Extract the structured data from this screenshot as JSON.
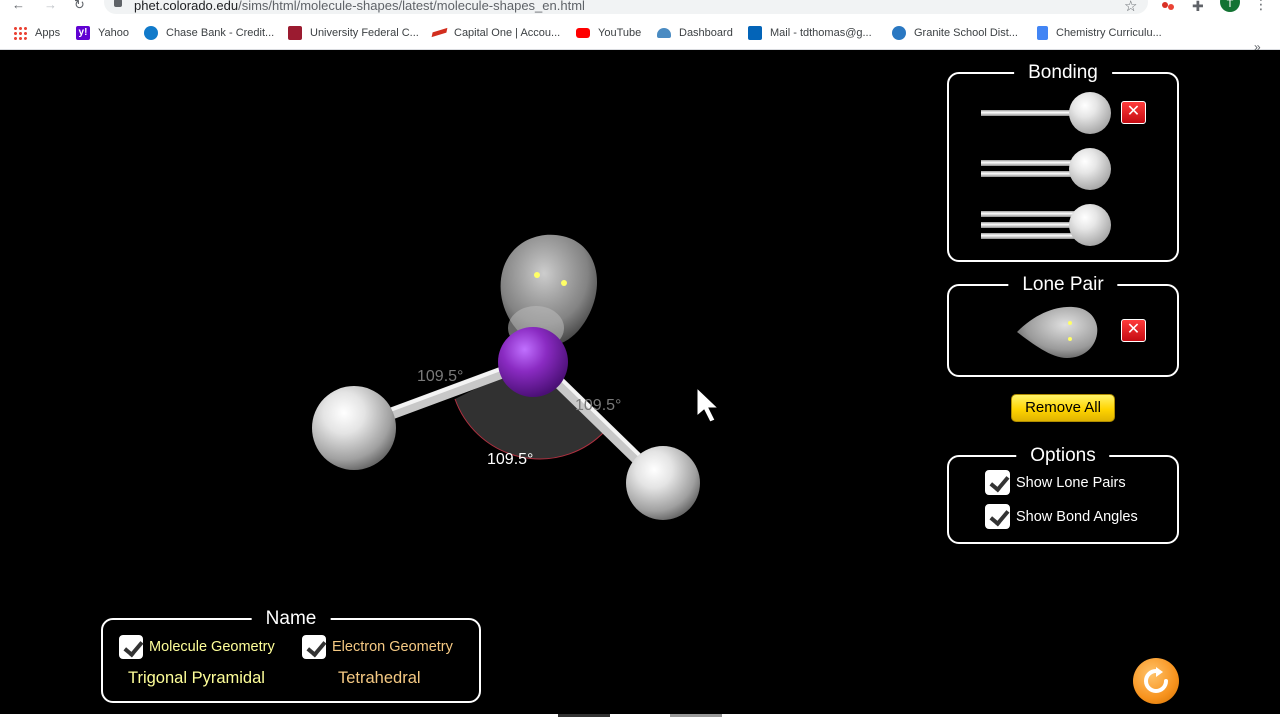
{
  "browser": {
    "url_host": "phet.colorado.edu",
    "url_path": "/sims/html/molecule-shapes/latest/molecule-shapes_en.html",
    "profile_initial": "T",
    "bookmarks": [
      {
        "label": "Apps",
        "icon": "apps-grid-icon"
      },
      {
        "label": "Yahoo",
        "icon": "yahoo-icon"
      },
      {
        "label": "Chase Bank - Credit...",
        "icon": "chase-icon"
      },
      {
        "label": "University Federal C...",
        "icon": "ufcu-icon"
      },
      {
        "label": "Capital One | Accou...",
        "icon": "capital-one-icon"
      },
      {
        "label": "YouTube",
        "icon": "youtube-icon"
      },
      {
        "label": "Dashboard",
        "icon": "dashboard-icon"
      },
      {
        "label": "Mail - tdthomas@g...",
        "icon": "outlook-icon"
      },
      {
        "label": "Granite School Dist...",
        "icon": "granite-icon"
      },
      {
        "label": "Chemistry Curriculu...",
        "icon": "google-doc-icon"
      }
    ],
    "bookmarks_overflow": "»"
  },
  "molecule": {
    "central_atom_color": "#8a2bc2",
    "bonded_atom_color": "#e8e8e8",
    "angles": [
      {
        "value": "109.5°",
        "faded": true
      },
      {
        "value": "109.5°",
        "faded": true
      },
      {
        "value": "109.5°",
        "faded": false
      }
    ]
  },
  "bonding_panel": {
    "title": "Bonding",
    "rows": [
      {
        "type": "single",
        "removable": true,
        "remove_label": "✕"
      },
      {
        "type": "double",
        "removable": false
      },
      {
        "type": "triple",
        "removable": false
      }
    ]
  },
  "lone_pair_panel": {
    "title": "Lone Pair",
    "remove_label": "✕"
  },
  "remove_all_label": "Remove All",
  "options_panel": {
    "title": "Options",
    "show_lone_pairs": {
      "label": "Show Lone Pairs",
      "checked": true
    },
    "show_bond_angles": {
      "label": "Show Bond Angles",
      "checked": true
    }
  },
  "name_panel": {
    "title": "Name",
    "molecule_geometry": {
      "label": "Molecule Geometry",
      "checked": true,
      "value": "Trigonal Pyramidal",
      "color": "#ffff99"
    },
    "electron_geometry": {
      "label": "Electron Geometry",
      "checked": true,
      "value": "Tetrahedral",
      "color": "#f5c983"
    }
  },
  "colors": {
    "accent_yellow": "#ffd400",
    "remove_red": "#d81e24",
    "reset_orange": "#f7931e"
  }
}
